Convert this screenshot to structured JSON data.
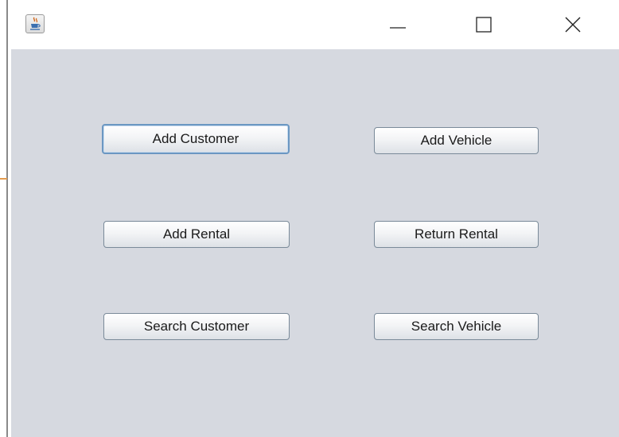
{
  "window": {
    "icon": "java-cup-icon",
    "controls": {
      "minimize": "minimize-icon",
      "maximize": "maximize-icon",
      "close": "close-icon"
    }
  },
  "menu": {
    "buttons": [
      {
        "id": "add-customer",
        "label": "Add Customer",
        "focused": true
      },
      {
        "id": "add-vehicle",
        "label": "Add Vehicle"
      },
      {
        "id": "add-rental",
        "label": "Add Rental"
      },
      {
        "id": "return-rental",
        "label": "Return Rental"
      },
      {
        "id": "search-customer",
        "label": "Search Customer"
      },
      {
        "id": "search-vehicle",
        "label": "Search Vehicle"
      }
    ]
  },
  "colors": {
    "content_background": "#d6d9e0",
    "focus_border": "#6b97c2",
    "button_border": "#7a8a99"
  }
}
